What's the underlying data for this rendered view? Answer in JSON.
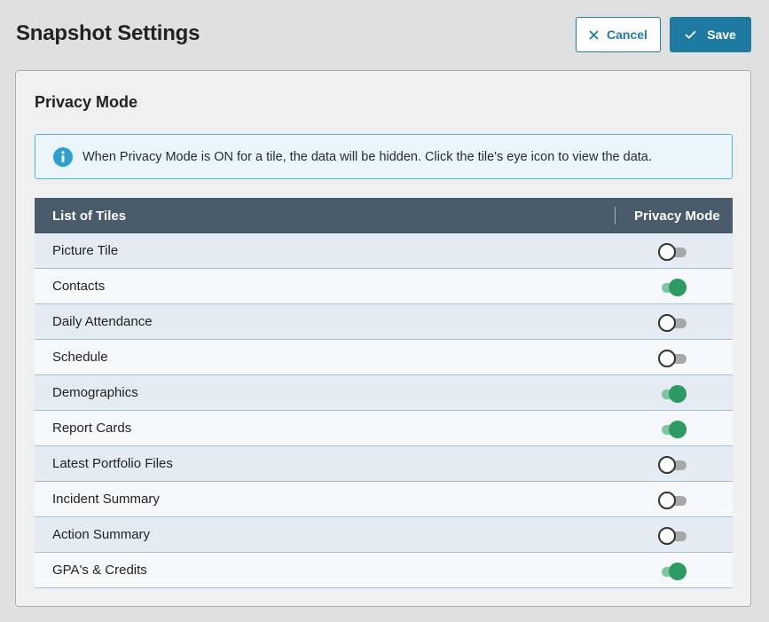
{
  "header": {
    "title": "Snapshot Settings",
    "cancel_label": "Cancel",
    "save_label": "Save"
  },
  "section": {
    "title": "Privacy Mode",
    "info_text": "When Privacy Mode is ON for a tile, the data will be hidden. Click the tile's eye icon to view the data.",
    "info_icon": "info-icon"
  },
  "table": {
    "columns": [
      "List of Tiles",
      "Privacy Mode"
    ],
    "rows": [
      {
        "label": "Picture Tile",
        "privacy": false
      },
      {
        "label": "Contacts",
        "privacy": true
      },
      {
        "label": "Daily Attendance",
        "privacy": false
      },
      {
        "label": "Schedule",
        "privacy": false
      },
      {
        "label": "Demographics",
        "privacy": true
      },
      {
        "label": "Report Cards",
        "privacy": true
      },
      {
        "label": "Latest Portfolio Files",
        "privacy": false
      },
      {
        "label": "Incident Summary",
        "privacy": false
      },
      {
        "label": "Action Summary",
        "privacy": false
      },
      {
        "label": "GPA's & Credits",
        "privacy": true
      }
    ]
  },
  "colors": {
    "accent": "#1f7aa2",
    "header_bg": "#495a6b",
    "toggle_on": "#2c9b63",
    "info_border": "#4fb5da"
  }
}
